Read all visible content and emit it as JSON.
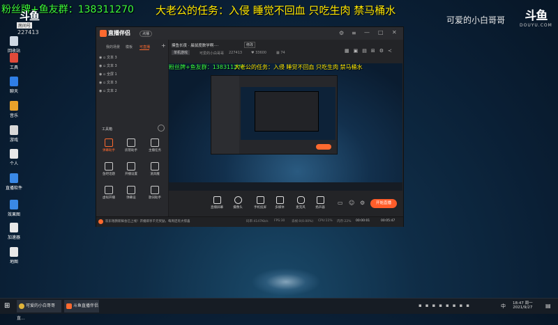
{
  "overlay": {
    "fan_text": "粉丝牌+鱼友群：138311270",
    "task_text": "大老公的任务：入侵 睡觉不回血  只吃生肉  禁马桶水",
    "streamer_name": "可爱的小白哥哥",
    "logo": "斗鱼",
    "logo_sub": "DOUYU.COM",
    "room_badge": "房间号",
    "room_id": "227413"
  },
  "desktop": {
    "icons": [
      {
        "label": "回收站",
        "color": "#cfd8e3"
      },
      {
        "label": "工具",
        "color": "#e04a3a"
      },
      {
        "label": "聊天",
        "color": "#2f7ee6"
      },
      {
        "label": "音乐",
        "color": "#e8a12a"
      },
      {
        "label": "游戏",
        "color": "#d8d8d8"
      },
      {
        "label": "个人",
        "color": "#e8e8e8"
      },
      {
        "label": "直播软件",
        "color": "#3a89e6"
      },
      {
        "label": "效果图",
        "color": "#3a89e6"
      },
      {
        "label": "加速器",
        "color": "#e8e8e8"
      },
      {
        "label": "地图",
        "color": "#e8e8e8"
      }
    ]
  },
  "app": {
    "title": "直播伴侣",
    "title_badge": "点播",
    "tabs": [
      "我的场景",
      "模板",
      "可直播"
    ],
    "active_tab": 2,
    "sources": [
      "文本 3",
      "文本 3",
      "全屏 1",
      "文本 3",
      "文本 2"
    ],
    "tools_header": "工具箱",
    "tools": [
      {
        "label": "弹幕助手",
        "active": true
      },
      {
        "label": "房管助手",
        "active": false
      },
      {
        "label": "主播任务",
        "active": false
      },
      {
        "label": "鱼吧话题",
        "active": false
      },
      {
        "label": "开播设置",
        "active": false
      },
      {
        "label": "道具魔",
        "active": false
      },
      {
        "label": "虚拟开播",
        "active": false
      },
      {
        "label": "弹幕设",
        "active": false
      },
      {
        "label": "歌词助手",
        "active": false
      }
    ],
    "stream_title": "摸鱼长夜 · 晨鼠度数学啊····",
    "stream_title_btn": "修改",
    "category_btn": "单机游戏",
    "room_info": "可爱的小白哥哥",
    "room_no": "227413",
    "fans": "33600",
    "viewers": "74",
    "bottom_actions": [
      "直播屏幕",
      "摄像头",
      "手机投屏",
      "多媒体",
      "麦克风",
      "扬声器"
    ],
    "start_button": "开始直播",
    "notice": "欢乐钱猜新鲜会已上线！开播即享千元奖励，每周还有大惊喜",
    "stats": [
      "码率:4147Kb/s",
      "FPS:30",
      "丢帧:0(0.00%)",
      "CPU:11%",
      "内存:22%"
    ],
    "time1": "00:00:01",
    "time2": "00:05:47"
  },
  "taskbar": {
    "items": [
      "可爱的小白哥哥直...",
      "斗鱼直播伴侣"
    ],
    "time": "18:47 周一",
    "date": "2021/9/27",
    "ime": "中"
  }
}
